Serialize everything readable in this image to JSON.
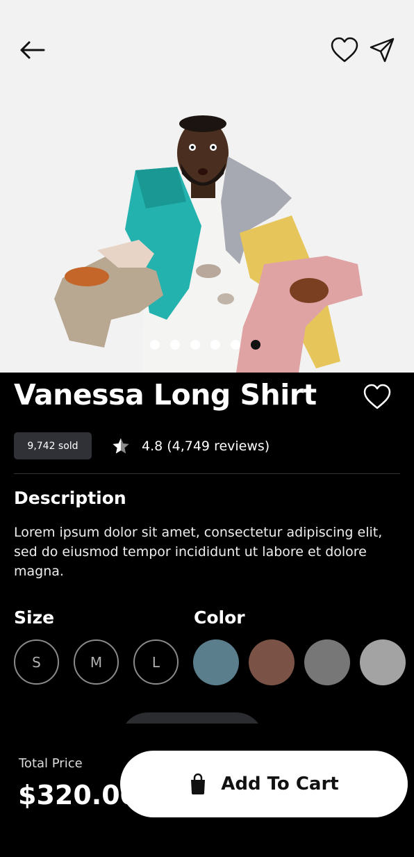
{
  "hero": {
    "slide_count": 6,
    "active_slide": 6
  },
  "product": {
    "name": "Vanessa Long Shirt",
    "sold": "9,742 sold",
    "rating": "4.8",
    "reviews": "(4,749 reviews)"
  },
  "description": {
    "heading": "Description",
    "text": "Lorem ipsum dolor sit amet, consectetur adipiscing elit, sed do eiusmod tempor incididunt ut labore et dolore magna."
  },
  "size": {
    "heading": "Size",
    "options": [
      "S",
      "M",
      "L"
    ]
  },
  "color": {
    "heading": "Color",
    "options": [
      "#5a7e8c",
      "#7a5346",
      "#777777",
      "#a3a3a3"
    ]
  },
  "footer": {
    "total_label": "Total Price",
    "total_price": "$320.00",
    "cart_label": "Add To Cart"
  },
  "icons": [
    "back-arrow-icon",
    "heart-icon",
    "send-icon",
    "star-half-icon",
    "shopping-bag-icon"
  ]
}
